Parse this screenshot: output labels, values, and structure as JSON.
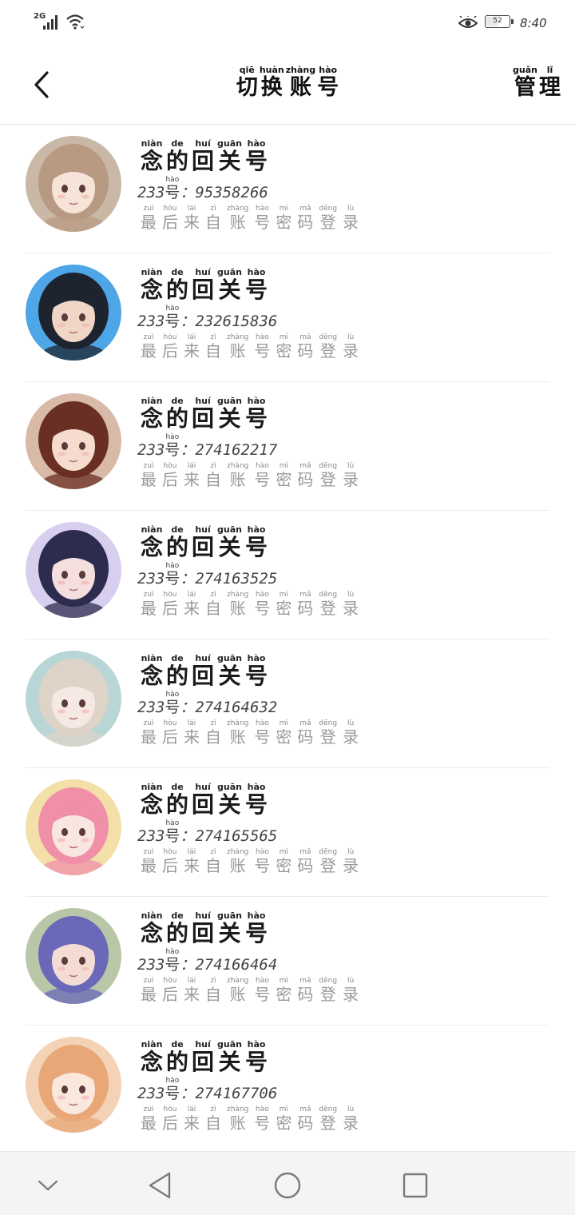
{
  "status": {
    "network": "2G",
    "battery": "52",
    "battery_level": 0.52,
    "time": "8:40"
  },
  "header": {
    "title": [
      {
        "py": "qiē",
        "hz": "切"
      },
      {
        "py": "huàn",
        "hz": "换"
      },
      {
        "py": "zhàng",
        "hz": "账"
      },
      {
        "py": "hào",
        "hz": "号"
      }
    ],
    "manage": [
      {
        "py": "guǎn",
        "hz": "管"
      },
      {
        "py": "lǐ",
        "hz": "理"
      }
    ],
    "back_icon": "chevron-left-icon"
  },
  "account_name": [
    {
      "py": "niàn",
      "hz": "念"
    },
    {
      "py": "de",
      "hz": "的"
    },
    {
      "py": "huí",
      "hz": "回"
    },
    {
      "py": "guān",
      "hz": "关"
    },
    {
      "py": "hào",
      "hz": "号"
    }
  ],
  "id_prefix": "233",
  "id_char": {
    "py": "hào",
    "hz": "号"
  },
  "id_sep": "：",
  "hint": [
    {
      "py": "zuì",
      "hz": "最"
    },
    {
      "py": "hòu",
      "hz": "后"
    },
    {
      "py": "lái",
      "hz": "来"
    },
    {
      "py": "zì",
      "hz": "自"
    },
    {
      "py": "zhàng",
      "hz": "账"
    },
    {
      "py": "hào",
      "hz": "号"
    },
    {
      "py": "mì",
      "hz": "密"
    },
    {
      "py": "mǎ",
      "hz": "码"
    },
    {
      "py": "dēng",
      "hz": "登"
    },
    {
      "py": "lù",
      "hz": "录"
    }
  ],
  "accounts": [
    {
      "id": "95358266",
      "avatar_bg": "#c9b8a6",
      "avatar_hair": "#b89a82",
      "avatar_skin": "#f6e4d8"
    },
    {
      "id": "232615836",
      "avatar_bg": "#4ea6e6",
      "avatar_hair": "#1d2430",
      "avatar_skin": "#f0d6c6"
    },
    {
      "id": "274162217",
      "avatar_bg": "#d9b9a8",
      "avatar_hair": "#6a2f24",
      "avatar_skin": "#f5dccf"
    },
    {
      "id": "274163525",
      "avatar_bg": "#d8cfee",
      "avatar_hair": "#2d2c4e",
      "avatar_skin": "#f4dede"
    },
    {
      "id": "274164632",
      "avatar_bg": "#b8d6d6",
      "avatar_hair": "#ddd3c6",
      "avatar_skin": "#f6e8e2"
    },
    {
      "id": "274165565",
      "avatar_bg": "#f2e0a8",
      "avatar_hair": "#ef8fa8",
      "avatar_skin": "#fae6e0"
    },
    {
      "id": "274166464",
      "avatar_bg": "#b9c7a8",
      "avatar_hair": "#6a68b8",
      "avatar_skin": "#f4dcd4"
    },
    {
      "id": "274167706",
      "avatar_bg": "#f4d2b6",
      "avatar_hair": "#e9a777",
      "avatar_skin": "#fae8dc"
    }
  ],
  "nav": [
    "chevron-down-icon",
    "back-triangle-icon",
    "home-circle-icon",
    "recents-square-icon"
  ]
}
